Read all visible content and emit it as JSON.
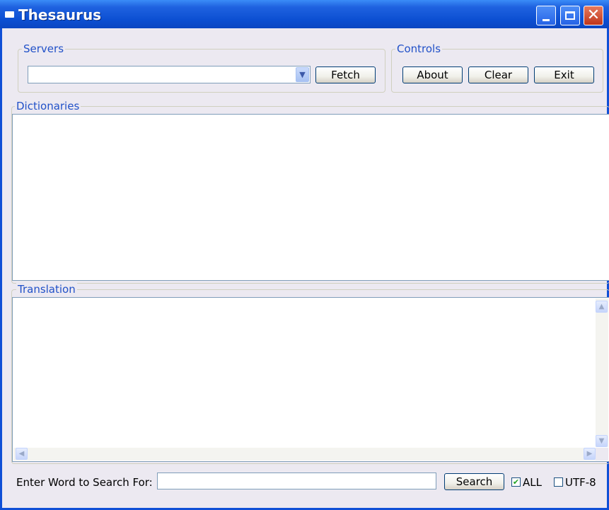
{
  "window": {
    "title": "Thesaurus"
  },
  "servers": {
    "legend": "Servers",
    "selected_value": "",
    "fetch_label": "Fetch"
  },
  "controls": {
    "legend": "Controls",
    "about_label": "About",
    "clear_label": "Clear",
    "exit_label": "Exit"
  },
  "dictionaries": {
    "legend": "Dictionaries",
    "items": []
  },
  "translation": {
    "legend": "Translation",
    "text": ""
  },
  "search": {
    "prompt": "Enter Word to Search For:",
    "value": "",
    "button_label": "Search",
    "all_label": "ALL",
    "all_checked": true,
    "utf8_label": "UTF-8",
    "utf8_checked": false
  },
  "icons": {
    "app": "app-icon",
    "minimize": "minimize-icon",
    "maximize": "maximize-icon",
    "close": "close-icon"
  }
}
